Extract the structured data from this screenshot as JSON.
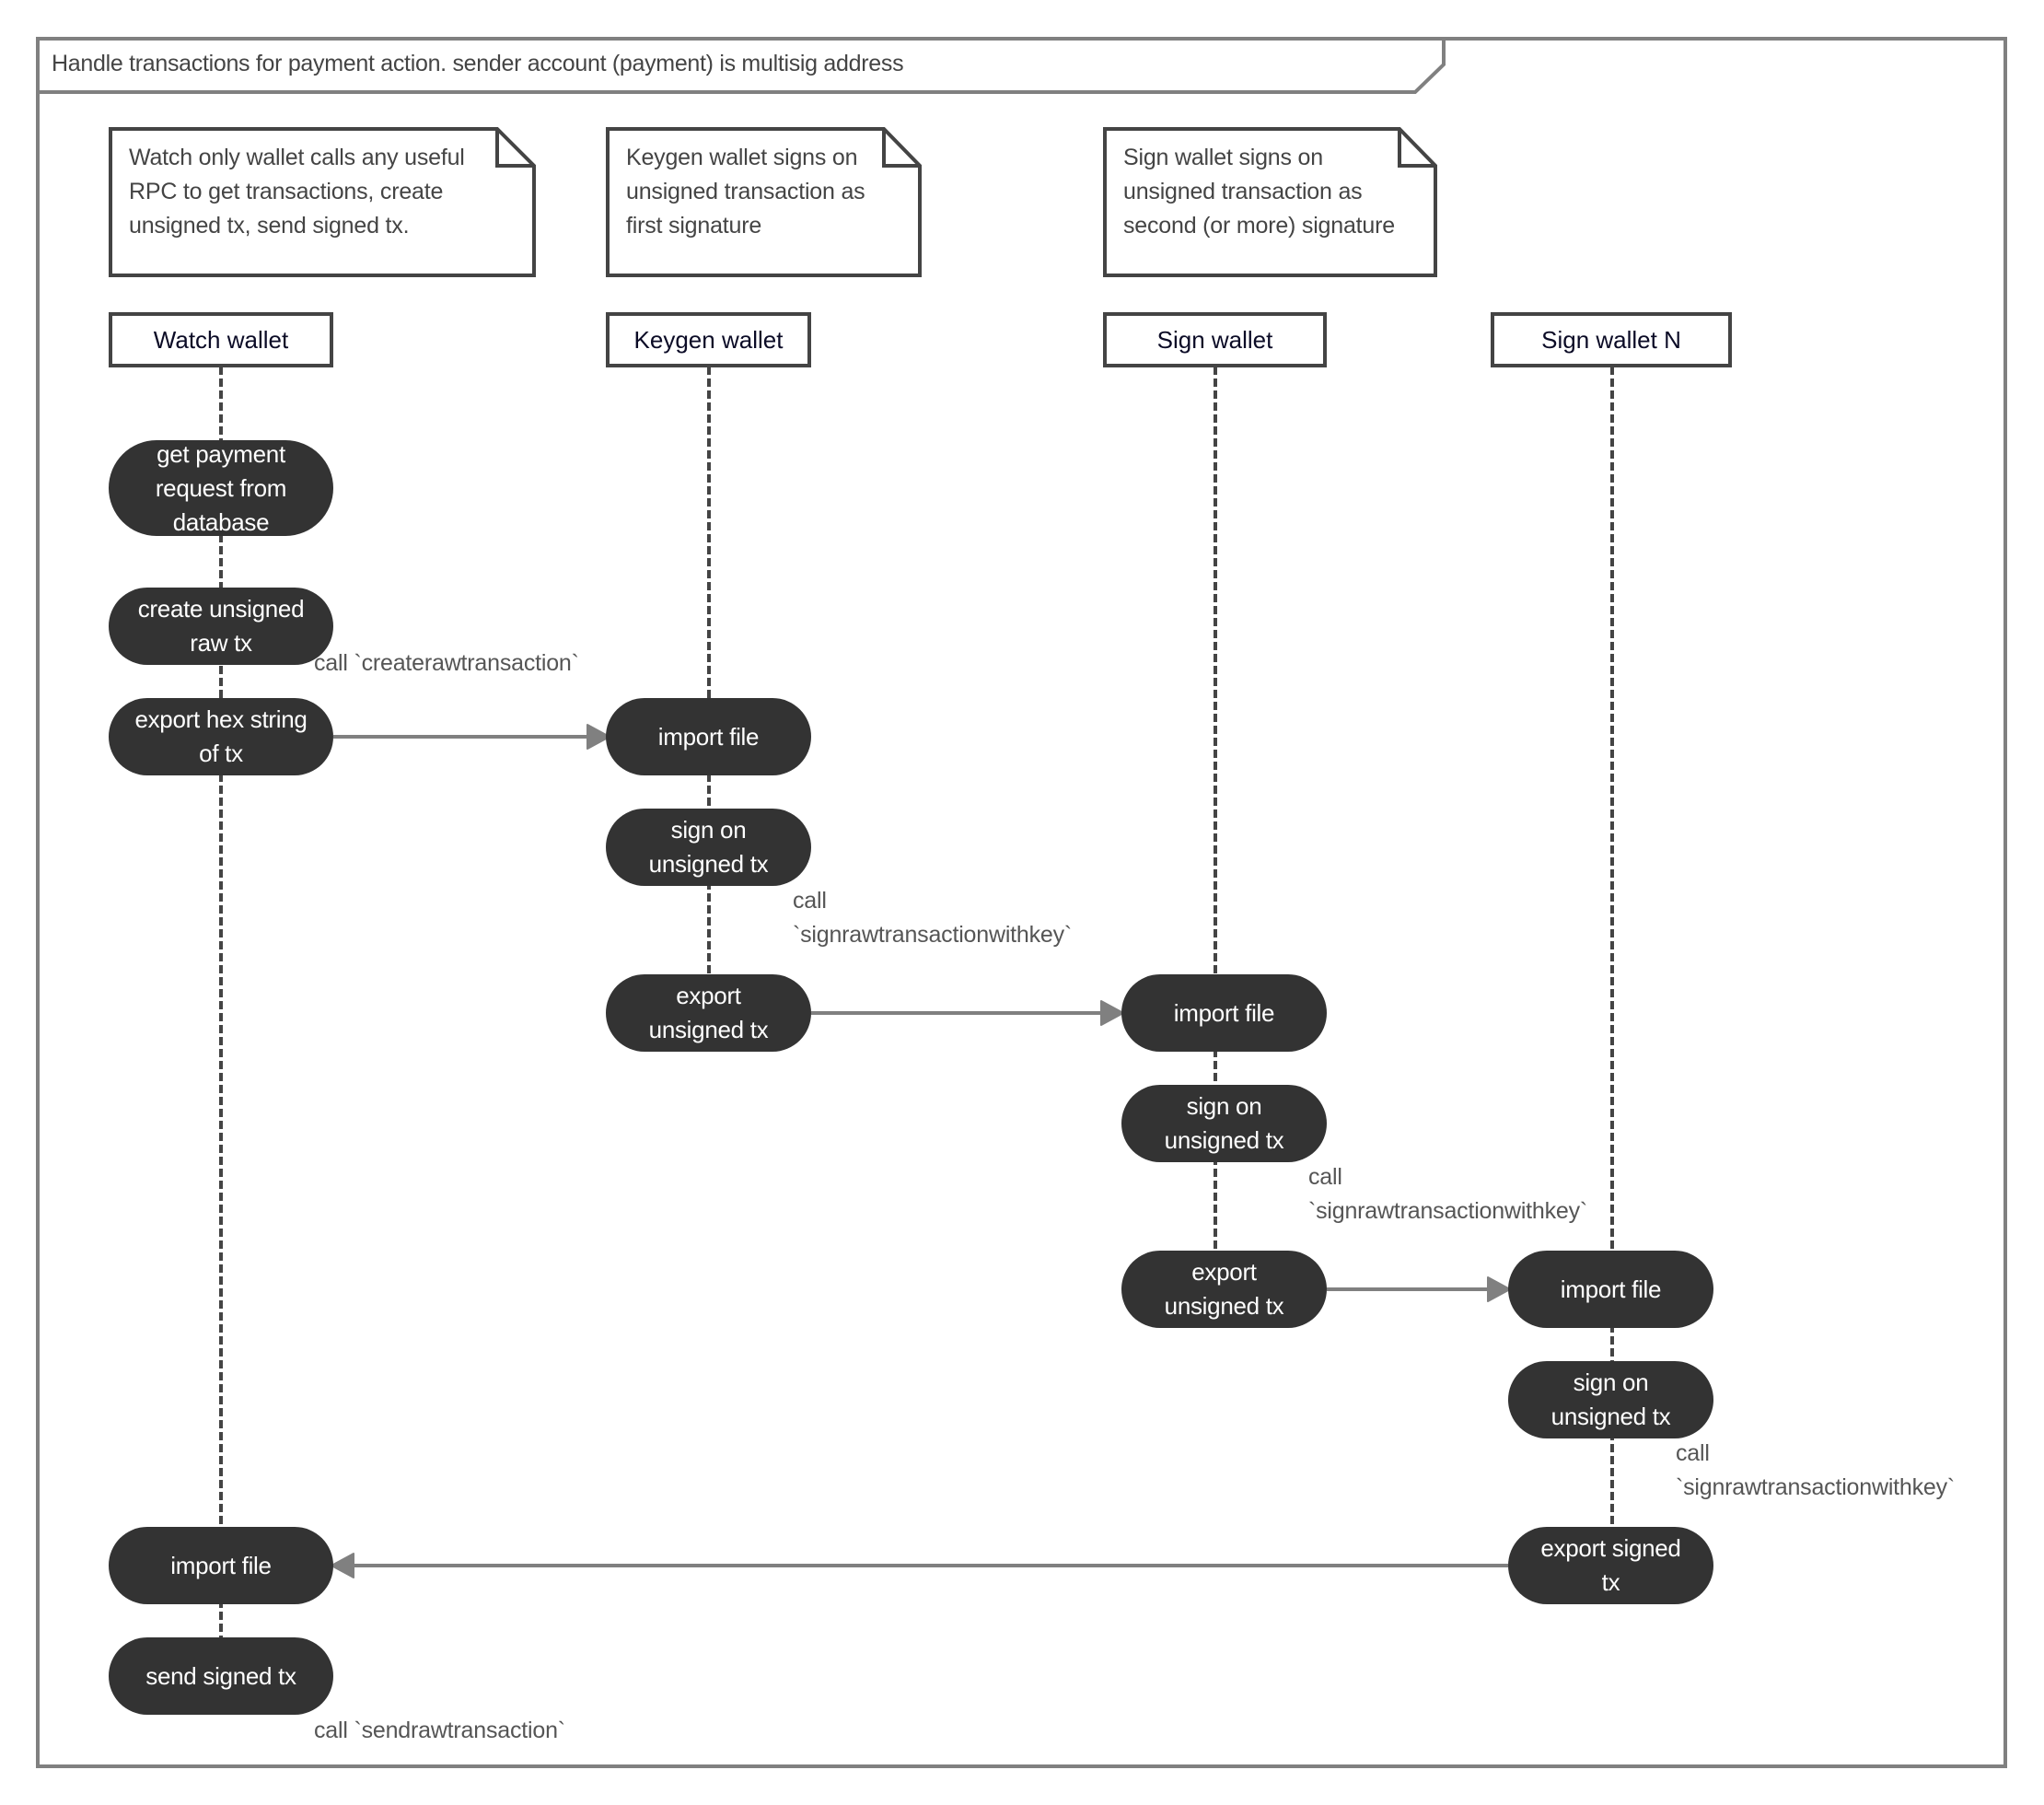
{
  "frame": {
    "title": "Handle transactions for payment action. sender account (payment) is multisig address"
  },
  "notes": [
    {
      "text": "Watch only wallet calls any useful\nRPC to get transactions, create\nunsigned tx, send signed tx."
    },
    {
      "text": "Keygen wallet signs on\nunsigned transaction as\nfirst signature"
    },
    {
      "text": "Sign wallet signs on\nunsigned transaction as\nsecond (or more) signature"
    }
  ],
  "lifelines": [
    {
      "id": "watch",
      "label": "Watch wallet"
    },
    {
      "id": "keygen",
      "label": "Keygen wallet"
    },
    {
      "id": "sign",
      "label": "Sign wallet"
    },
    {
      "id": "signN",
      "label": "Sign wallet N"
    }
  ],
  "activities": {
    "watch": [
      {
        "label": "get payment\nrequest from\ndatabase"
      },
      {
        "label": "create unsigned\nraw tx"
      },
      {
        "label": "export hex string\nof tx"
      },
      {
        "label": "import file"
      },
      {
        "label": "send signed tx"
      }
    ],
    "keygen": [
      {
        "label": "import file"
      },
      {
        "label": "sign on\nunsigned tx"
      },
      {
        "label": "export\nunsigned tx"
      }
    ],
    "sign": [
      {
        "label": "import file"
      },
      {
        "label": "sign on\nunsigned tx"
      },
      {
        "label": "export\nunsigned tx"
      }
    ],
    "signN": [
      {
        "label": "import file"
      },
      {
        "label": "sign on\nunsigned tx"
      },
      {
        "label": "export signed\ntx"
      }
    ]
  },
  "call_labels": [
    {
      "text": "call `createrawtransaction`"
    },
    {
      "text": "call\n`signrawtransactionwithkey`"
    },
    {
      "text": "call\n`signrawtransactionwithkey`"
    },
    {
      "text": "call\n`signrawtransactionwithkey`"
    },
    {
      "text": "call `sendrawtransaction`"
    }
  ],
  "messages": [
    {
      "from": "watch: export hex string of tx",
      "to": "keygen: import file"
    },
    {
      "from": "keygen: export unsigned tx",
      "to": "sign: import file"
    },
    {
      "from": "sign: export unsigned tx",
      "to": "signN: import file"
    },
    {
      "from": "signN: export signed tx",
      "to": "watch: import file"
    }
  ],
  "colors": {
    "frame": "#808080",
    "activity_fill": "#333333",
    "activity_text": "#ffffff",
    "arrow": "#808080",
    "lifeline": "#444444",
    "header_text": "#0b0b26"
  }
}
